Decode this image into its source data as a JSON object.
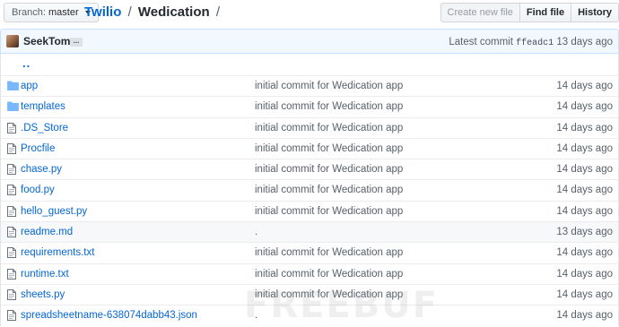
{
  "branch": {
    "label": "Branch:",
    "value": "master"
  },
  "breadcrumb": {
    "repo": "Twilio",
    "separator": "/",
    "dir": "Wedication",
    "trail": "/"
  },
  "buttons": {
    "create": "Create new file",
    "find": "Find file",
    "history": "History"
  },
  "commit": {
    "author": "SeekTom .",
    "ellipsis": "...",
    "latest_label": "Latest commit",
    "sha": "ffeadc1",
    "age": "13 days ago"
  },
  "up_label": "..",
  "files": [
    {
      "name": "app",
      "type": "folder",
      "message": "initial commit for Wedication app",
      "age": "14 days ago"
    },
    {
      "name": "templates",
      "type": "folder",
      "message": "initial commit for Wedication app",
      "age": "14 days ago"
    },
    {
      "name": ".DS_Store",
      "type": "file",
      "message": "initial commit for Wedication app",
      "age": "14 days ago"
    },
    {
      "name": "Procfile",
      "type": "file",
      "message": "initial commit for Wedication app",
      "age": "14 days ago"
    },
    {
      "name": "chase.py",
      "type": "file",
      "message": "initial commit for Wedication app",
      "age": "14 days ago"
    },
    {
      "name": "food.py",
      "type": "file",
      "message": "initial commit for Wedication app",
      "age": "14 days ago"
    },
    {
      "name": "hello_guest.py",
      "type": "file",
      "message": "initial commit for Wedication app",
      "age": "14 days ago"
    },
    {
      "name": "readme.md",
      "type": "file",
      "message": ".",
      "age": "13 days ago"
    },
    {
      "name": "requirements.txt",
      "type": "file",
      "message": "initial commit for Wedication app",
      "age": "14 days ago"
    },
    {
      "name": "runtime.txt",
      "type": "file",
      "message": "initial commit for Wedication app",
      "age": "14 days ago"
    },
    {
      "name": "sheets.py",
      "type": "file",
      "message": "initial commit for Wedication app",
      "age": "14 days ago"
    },
    {
      "name": "spreadsheetname-638074dabb43.json",
      "type": "file",
      "message": ".",
      "age": "14 days ago"
    }
  ],
  "watermark": "FREEBUF",
  "colors": {
    "link": "#0366d6",
    "folder": "#79b8ff",
    "commit_bg": "#f1f8ff"
  }
}
